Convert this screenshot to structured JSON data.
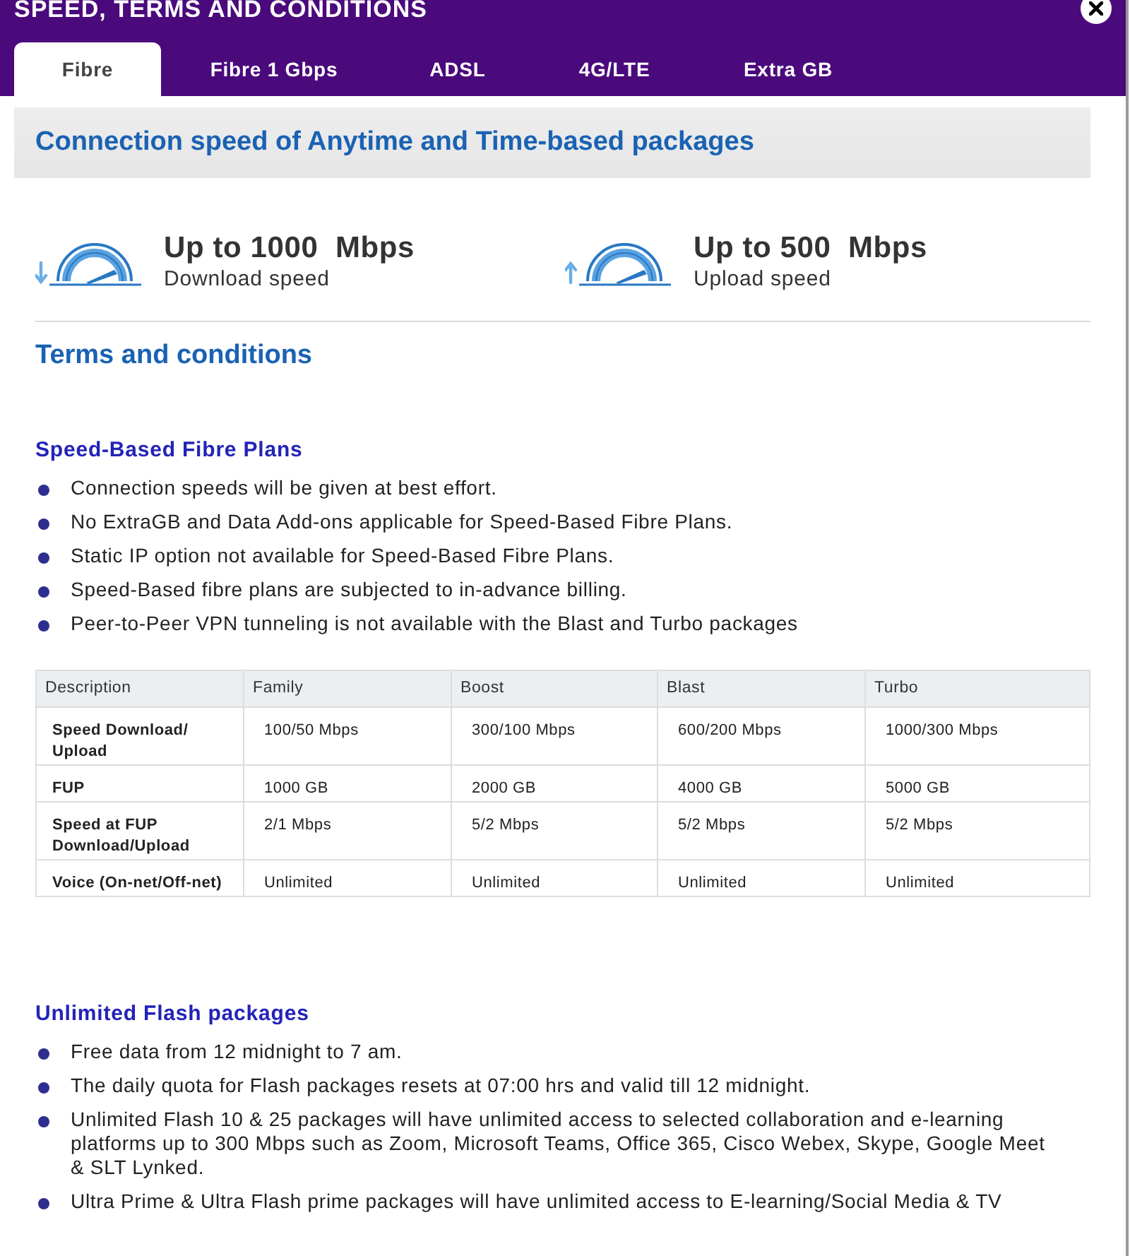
{
  "dialog": {
    "title": "SPEED, TERMS AND CONDITIONS"
  },
  "tabs": [
    {
      "label": "Fibre",
      "selected": true
    },
    {
      "label": "Fibre 1 Gbps",
      "selected": false
    },
    {
      "label": "ADSL",
      "selected": false
    },
    {
      "label": "4G/LTE",
      "selected": false
    },
    {
      "label": "Extra GB",
      "selected": false
    }
  ],
  "banner": {
    "title": "Connection speed of Anytime and Time-based packages"
  },
  "speeds": [
    {
      "kind": "download",
      "value": "Up to 1000  Mbps",
      "label": "Download speed"
    },
    {
      "kind": "upload",
      "value": "Up to 500  Mbps",
      "label": "Upload speed"
    }
  ],
  "terms": {
    "heading": "Terms and conditions",
    "sections": [
      {
        "heading": "Speed-Based Fibre Plans",
        "bullets": [
          "Connection speeds will be given at best effort.",
          "No ExtraGB and Data Add-ons applicable for Speed-Based Fibre Plans.",
          "Static IP option not available for Speed-Based Fibre Plans.",
          "Speed-Based fibre plans are subjected to in-advance billing.",
          "Peer-to-Peer VPN tunneling is not available with the Blast and Turbo packages"
        ],
        "table": {
          "columns": [
            "Description",
            "Family",
            "Boost",
            "Blast",
            "Turbo"
          ],
          "rows": [
            [
              "Speed Download/ Upload",
              "100/50 Mbps",
              "300/100 Mbps",
              "600/200 Mbps",
              "1000/300 Mbps"
            ],
            [
              "FUP",
              "1000 GB",
              "2000 GB",
              "4000 GB",
              "5000 GB"
            ],
            [
              "Speed at FUP Download/Upload",
              "2/1 Mbps",
              "5/2 Mbps",
              "5/2 Mbps",
              "5/2 Mbps"
            ],
            [
              "Voice (On-net/Off-net)",
              "Unlimited",
              "Unlimited",
              "Unlimited",
              "Unlimited"
            ]
          ]
        }
      },
      {
        "heading": "Unlimited Flash packages",
        "bullets": [
          "Free data from 12 midnight to 7 am.",
          "The daily quota for Flash packages resets at 07:00 hrs and valid till 12 midnight.",
          "Unlimited Flash 10 & 25 packages will have unlimited access to selected collaboration and e-learning platforms up to 300 Mbps such as Zoom, Microsoft Teams, Office 365, Cisco Webex, Skype, Google Meet & SLT Lynked.",
          "Ultra Prime & Ultra Flash prime packages will have unlimited access to E-learning/Social Media & TV"
        ]
      }
    ]
  }
}
